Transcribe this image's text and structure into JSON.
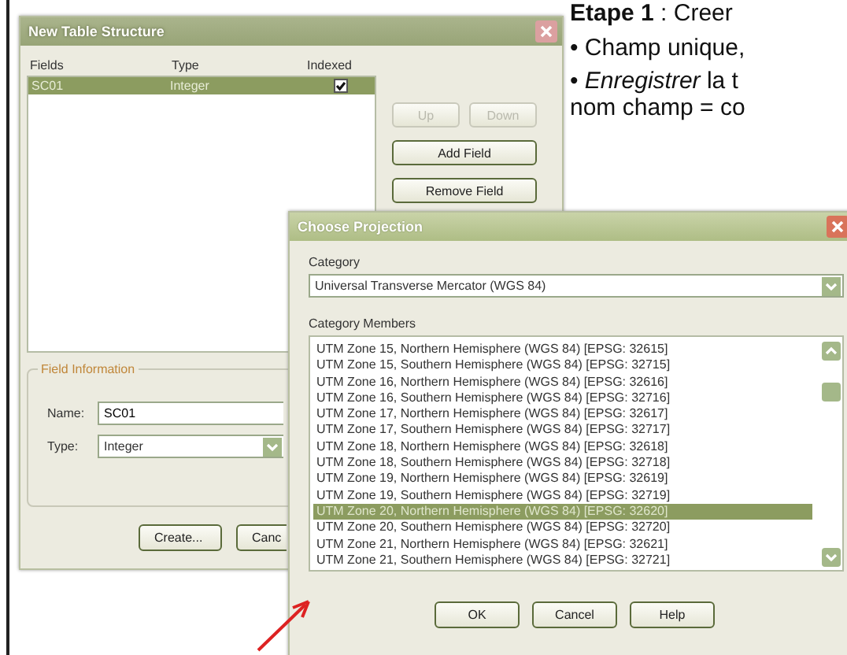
{
  "slide": {
    "heading": "**Etape 1** : Creer",
    "bullets": [
      {
        "text": "• Champ unique,"
      },
      {
        "text": "• *Enregistrer* la t"
      }
    ],
    "continuation": "nom champ = co"
  },
  "table_dialog": {
    "title": "New Table Structure",
    "columns": [
      "Fields",
      "Type",
      "Indexed"
    ],
    "rows": [
      {
        "field": "SC01",
        "type": "Integer",
        "indexed": true,
        "selected": true
      }
    ],
    "side_buttons": [
      {
        "label": "Up",
        "disabled": true
      },
      {
        "label": "Down",
        "disabled": true
      },
      {
        "label": "Add Field",
        "disabled": false
      },
      {
        "label": "Remove Field",
        "disabled": false
      }
    ],
    "field_information": {
      "title": "Field Information",
      "name_label": "Name:",
      "name_value": "SC01",
      "type_label": "Type:",
      "type_value": "Integer"
    },
    "buttons": [
      "Create...",
      "Canc"
    ]
  },
  "projection_dialog": {
    "title": "Choose Projection",
    "category_label": "Category",
    "category_value": "Universal Transverse Mercator (WGS 84)",
    "members_label": "Category Members",
    "members": [
      {
        "label": "UTM Zone 15, Northern Hemisphere (WGS 84) [EPSG: 32615]",
        "selected": false
      },
      {
        "label": "UTM Zone 15, Southern Hemisphere (WGS 84) [EPSG: 32715]",
        "selected": false
      },
      {
        "label": "UTM Zone 16, Northern Hemisphere (WGS 84) [EPSG: 32616]",
        "selected": false
      },
      {
        "label": "UTM Zone 16, Southern Hemisphere (WGS 84) [EPSG: 32716]",
        "selected": false
      },
      {
        "label": "UTM Zone 17, Northern Hemisphere (WGS 84) [EPSG: 32617]",
        "selected": false
      },
      {
        "label": "UTM Zone 17, Southern Hemisphere (WGS 84) [EPSG: 32717]",
        "selected": false
      },
      {
        "label": "UTM Zone 18, Northern Hemisphere (WGS 84) [EPSG: 32618]",
        "selected": false
      },
      {
        "label": "UTM Zone 18, Southern Hemisphere (WGS 84) [EPSG: 32718]",
        "selected": false
      },
      {
        "label": "UTM Zone 19, Northern Hemisphere (WGS 84) [EPSG: 32619]",
        "selected": false
      },
      {
        "label": "UTM Zone 19, Southern Hemisphere (WGS 84) [EPSG: 32719]",
        "selected": false
      },
      {
        "label": "UTM Zone 20, Northern Hemisphere (WGS 84) [EPSG: 32620]",
        "selected": true
      },
      {
        "label": "UTM Zone 20, Southern Hemisphere (WGS 84) [EPSG: 32720]",
        "selected": false
      },
      {
        "label": "UTM Zone 21, Northern Hemisphere (WGS 84) [EPSG: 32621]",
        "selected": false
      },
      {
        "label": "UTM Zone 21, Southern Hemisphere (WGS 84) [EPSG: 32721]",
        "selected": false
      }
    ],
    "buttons": [
      "OK",
      "Cancel",
      "Help"
    ]
  }
}
